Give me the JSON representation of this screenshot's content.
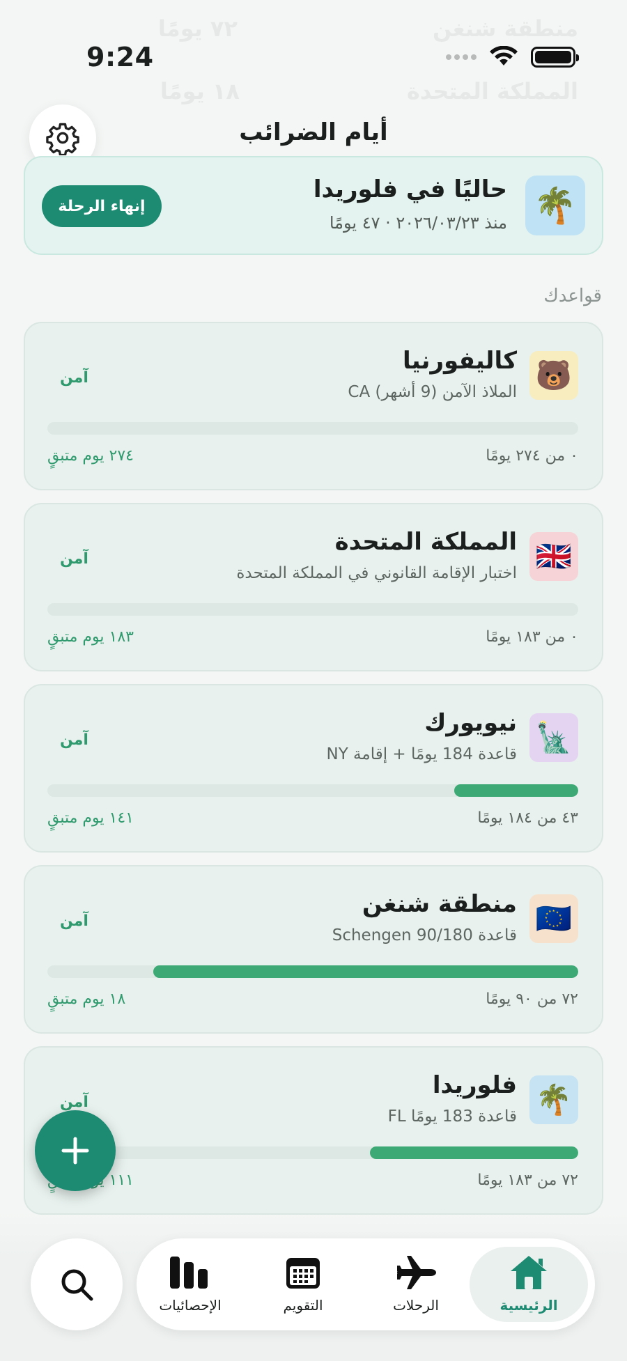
{
  "status_bar": {
    "time": "9:24"
  },
  "background_rows": [
    {
      "name": "منطقة شنغن",
      "value": "٧٢ يومًا"
    },
    {
      "name": "المملكة المتحدة",
      "value": "١٨ يومًا"
    }
  ],
  "header": {
    "title": "أيام الضرائب"
  },
  "current_trip": {
    "emoji": "🌴",
    "title": "حاليًا في فلوريدا",
    "subtitle": "منذ ٢٠٢٦/٠٣/٢٣ · ٤٧ يومًا",
    "end_button": "إنهاء الرحلة"
  },
  "section_label": "قواعدك",
  "rules": [
    {
      "emoji": "🐻",
      "emoji_bg": "#f7edbf",
      "name": "كاليفورنيا",
      "desc": "الملاذ الآمن (9 أشهر) CA",
      "status": "آمن",
      "progress": 0,
      "used": "٠ من ٢٧٤ يومًا",
      "remaining": "٢٧٤ يوم متبقٍ"
    },
    {
      "emoji": "🇬🇧",
      "emoji_bg": "#f6d3d6",
      "name": "المملكة المتحدة",
      "desc": "اختبار الإقامة القانوني في المملكة المتحدة",
      "status": "آمن",
      "progress": 0,
      "used": "٠ من ١٨٣ يومًا",
      "remaining": "١٨٣ يوم متبقٍ"
    },
    {
      "emoji": "🗽",
      "emoji_bg": "#e5d3f2",
      "name": "نيويورك",
      "desc": "قاعدة 184 يومًا + إقامة NY",
      "status": "آمن",
      "progress": 0.234,
      "used": "٤٣ من ١٨٤ يومًا",
      "remaining": "١٤١ يوم متبقٍ"
    },
    {
      "emoji": "🇪🇺",
      "emoji_bg": "#f6e2cc",
      "name": "منطقة شنغن",
      "desc": "قاعدة Schengen 90/180",
      "status": "آمن",
      "progress": 0.8,
      "used": "٧٢ من ٩٠ يومًا",
      "remaining": "١٨ يوم متبقٍ"
    },
    {
      "emoji": "🌴",
      "emoji_bg": "#c6e3f4",
      "name": "فلوريدا",
      "desc": "قاعدة 183 يومًا FL",
      "status": "آمن",
      "progress": 0.393,
      "used": "٧٢ من ١٨٣ يومًا",
      "remaining": "١١١ يوم متبقٍ"
    }
  ],
  "tabs": [
    {
      "label": "الرئيسية",
      "icon": "home-icon",
      "active": true
    },
    {
      "label": "الرحلات",
      "icon": "plane-icon",
      "active": false
    },
    {
      "label": "التقويم",
      "icon": "calendar-icon",
      "active": false
    },
    {
      "label": "الإحصائيات",
      "icon": "stats-icon",
      "active": false
    }
  ],
  "colors": {
    "accent": "#1d8a72",
    "safe": "#2f9a6d",
    "progress": "#3daa75"
  }
}
